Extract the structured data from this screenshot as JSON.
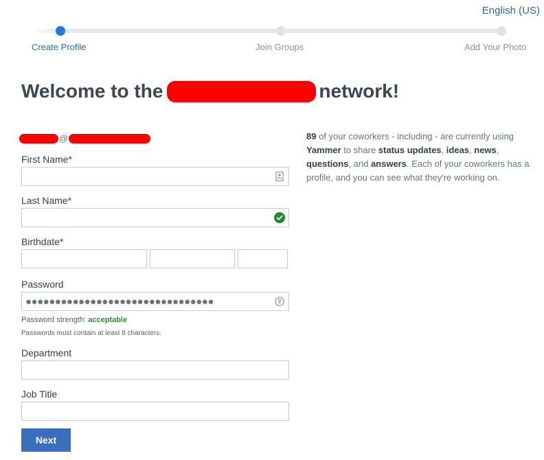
{
  "language": "English (US)",
  "steps": [
    {
      "label": "Create Profile",
      "active": true
    },
    {
      "label": "Join Groups",
      "active": false
    },
    {
      "label": "Add Your Photo",
      "active": false
    }
  ],
  "welcome": {
    "prefix": "Welcome to the",
    "suffix": "network!"
  },
  "email": {
    "at": "@"
  },
  "fields": {
    "first_name": {
      "label": "First Name*",
      "value": ""
    },
    "last_name": {
      "label": "Last Name*",
      "value": ""
    },
    "birthdate": {
      "label": "Birthdate*",
      "month": "",
      "day": "",
      "year": ""
    },
    "password": {
      "label": "Password",
      "masked": "●●●●●●●●●●●●●●●●●●●●●●●●●●●●●●●●"
    },
    "department": {
      "label": "Department",
      "value": ""
    },
    "job_title": {
      "label": "Job Title",
      "value": ""
    }
  },
  "password_strength": {
    "label": "Password strength:",
    "value": "acceptable",
    "color": "#2f8f2f"
  },
  "password_rule": "Passwords must contain at least 8 characters.",
  "next_label": "Next",
  "info": {
    "count": "89",
    "t1": " of your coworkers - including - are currently using ",
    "app": "Yammer",
    "t2": " to share ",
    "b1": "status updates",
    "c1": ", ",
    "b2": "ideas",
    "c2": ", ",
    "b3": "news",
    "c3": ", ",
    "b4": "questions",
    "c4": ", and ",
    "b5": "answers",
    "t3": ". Each of your coworkers has a profile, and you can see what they're working on."
  },
  "colors": {
    "accent": "#1e7bd6",
    "button": "#3a6fc0",
    "valid": "#1e8c2e",
    "redaction": "#ff0000"
  },
  "icons": {
    "first_name": "contact-card-icon",
    "last_name": "check-circle-icon",
    "password": "password-reveal-icon"
  }
}
